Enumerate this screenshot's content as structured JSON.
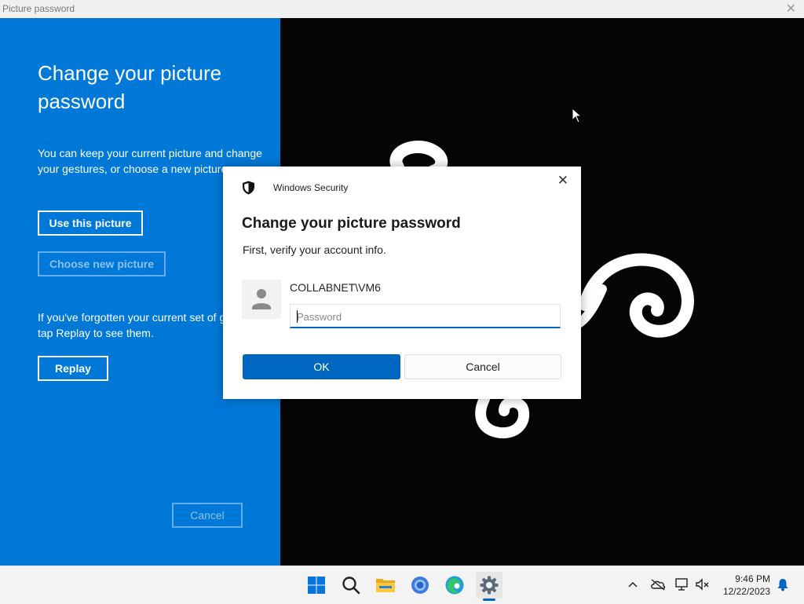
{
  "window": {
    "title": "Picture password",
    "close_glyph": "✕"
  },
  "left_panel": {
    "heading": "Change your picture password",
    "keep_text": "You can keep your current picture and change your gestures, or choose a new picture.",
    "use_picture_label": "Use this picture",
    "choose_picture_label": "Choose new picture",
    "forgot_text": "If you've forgotten your current set of gestures, tap Replay to see them.",
    "replay_label": "Replay",
    "cancel_label": "Cancel",
    "background_color": "#0078d7"
  },
  "dialog": {
    "app_name": "Windows Security",
    "close_glyph": "✕",
    "heading": "Change your picture password",
    "subtext": "First, verify your account info.",
    "account_name": "COLLABNET\\VM6",
    "password_placeholder": "Password",
    "password_value": "",
    "ok_label": "OK",
    "cancel_label": "Cancel",
    "accent_color": "#0067c0"
  },
  "taskbar": {
    "icons": [
      "windows-start-icon",
      "search-icon",
      "file-explorer-icon",
      "chrome-icon",
      "edge-icon",
      "settings-icon"
    ],
    "active_app": "settings-icon",
    "tray_icons": [
      "chevron-up-icon",
      "onedrive-offline-icon",
      "network-icon",
      "volume-muted-icon",
      "notification-bell-icon"
    ],
    "time": "9:46 PM",
    "date": "12/22/2023"
  }
}
